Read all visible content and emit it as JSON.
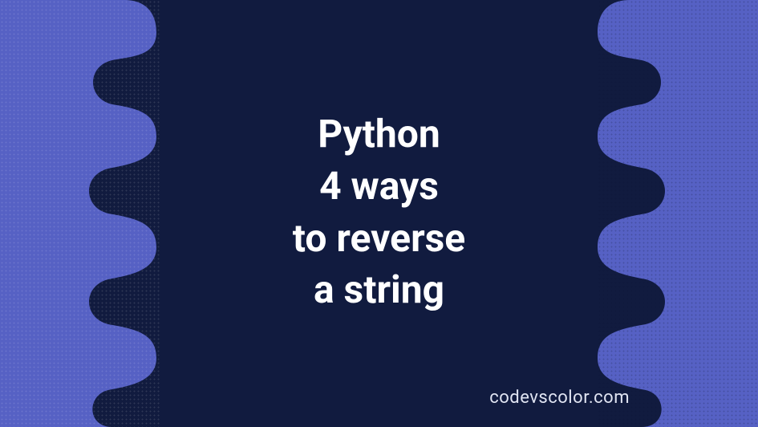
{
  "title": {
    "line1": "Python",
    "line2": "4 ways",
    "line3": "to reverse",
    "line4": "a string"
  },
  "watermark": "codevscolor.com",
  "colors": {
    "background": "#5661c4",
    "dark_shape": "#111b3f",
    "text": "#ffffff",
    "watermark_text": "#e0e4f2"
  }
}
